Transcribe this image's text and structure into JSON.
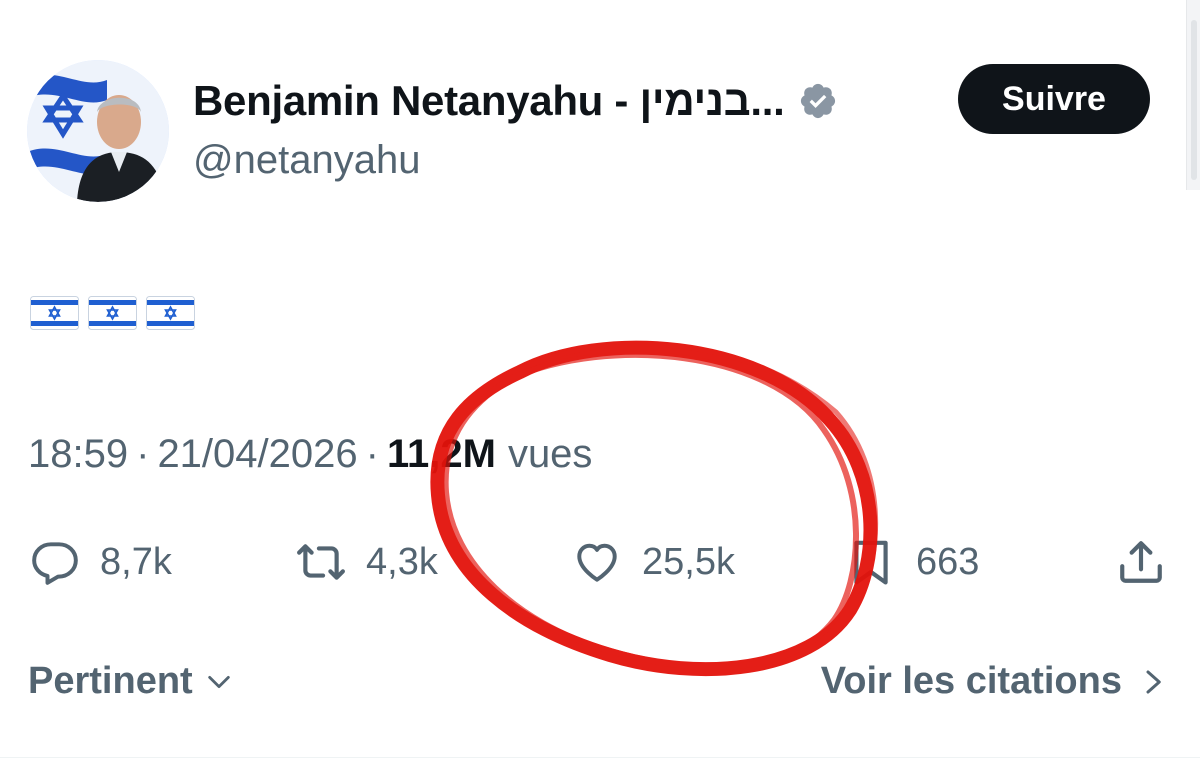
{
  "tweet": {
    "author": {
      "display_name": "Benjamin Netanyahu - בנימין...",
      "handle": "@netanyahu",
      "verified": true
    },
    "follow_label": "Suivre",
    "body_emoji": [
      "🇮🇱",
      "🇮🇱",
      "🇮🇱"
    ],
    "time": "18:59",
    "separator": "·",
    "date": "21/04/2026",
    "views_count": "11,2M",
    "views_label": "vues"
  },
  "actions": {
    "replies": "8,7k",
    "reposts": "4,3k",
    "likes": "25,5k",
    "bookmarks": "663"
  },
  "footer": {
    "sort_label": "Pertinent",
    "quotes_label": "Voir les citations"
  },
  "colors": {
    "text_primary": "#0f1419",
    "text_secondary": "#536471",
    "verified_badge": "#8a96a3",
    "annotation_red": "#e3120b"
  },
  "icons": {
    "reply": "speech-bubble-icon",
    "repost": "repost-icon",
    "like": "heart-icon",
    "bookmark": "bookmark-icon",
    "share": "share-icon"
  }
}
